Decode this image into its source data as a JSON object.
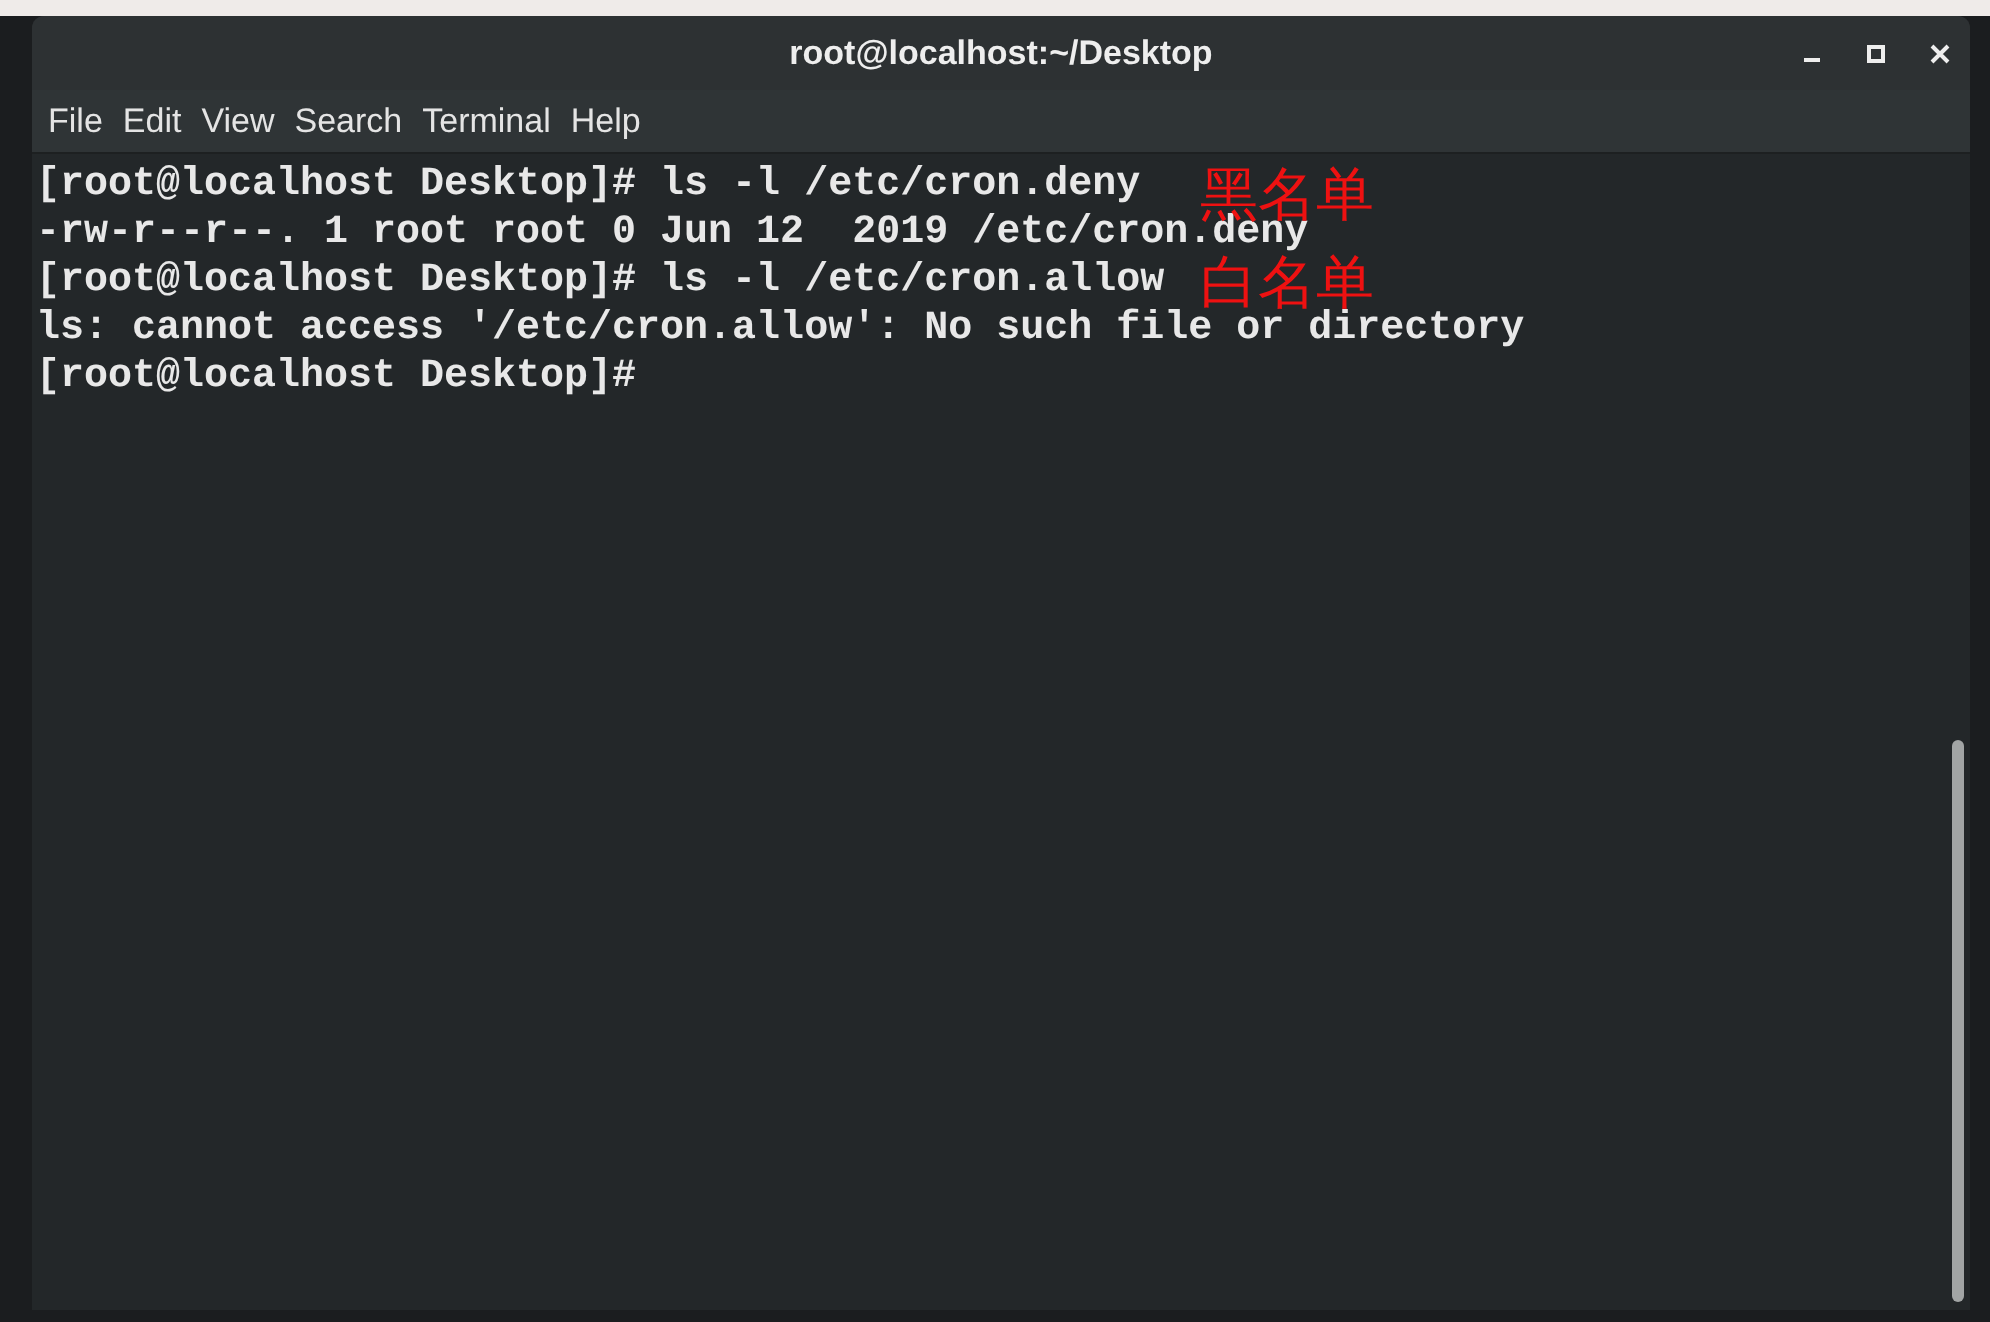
{
  "window": {
    "title": "root@localhost:~/Desktop"
  },
  "menu": [
    "File",
    "Edit",
    "View",
    "Search",
    "Terminal",
    "Help"
  ],
  "terminal_lines": [
    "[root@localhost Desktop]# ls -l /etc/cron.deny",
    "-rw-r--r--. 1 root root 0 Jun 12  2019 /etc/cron.deny",
    "[root@localhost Desktop]# ls -l /etc/cron.allow",
    "ls: cannot access '/etc/cron.allow': No such file or directory",
    "[root@localhost Desktop]#"
  ],
  "annotations": [
    {
      "text": "黑名单",
      "color": "#ee1111"
    },
    {
      "text": "白名单",
      "color": "#ee1111"
    }
  ]
}
